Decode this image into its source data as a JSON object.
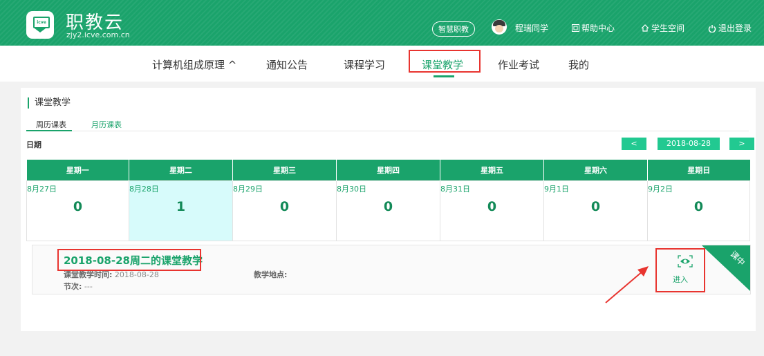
{
  "header": {
    "brand_title": "职教云",
    "brand_subtitle": "zjy2.icve.com.cn",
    "logo_text": "icve",
    "smart_button": "智慧职教",
    "user_name": "程瑞同学",
    "help_center": "帮助中心",
    "student_space": "学生空间",
    "logout": "退出登录"
  },
  "subnav": {
    "course": "计算机组成原理 ^",
    "notice": "通知公告",
    "learning": "课程学习",
    "classroom": "课堂教学",
    "homework": "作业考试",
    "mine": "我的"
  },
  "panel": {
    "title": "课堂教学",
    "tab_week": "周历课表",
    "tab_month": "月历课表",
    "date_label": "日期",
    "prev": "<",
    "next": ">",
    "current_date": "2018-08-28"
  },
  "week": {
    "headers": [
      "星期一",
      "星期二",
      "星期三",
      "星期四",
      "星期五",
      "星期六",
      "星期日"
    ],
    "days": [
      "8月27日",
      "8月28日",
      "8月29日",
      "8月30日",
      "8月31日",
      "9月1日",
      "9月2日"
    ],
    "counts": [
      "0",
      "1",
      "0",
      "0",
      "0",
      "0",
      "0"
    ]
  },
  "card": {
    "title": "2018-08-28周二的课堂教学",
    "time_label": "课堂教学时间:",
    "time_value": "2018-08-28",
    "place_label": "教学地点:",
    "place_value": "",
    "period_label": "节次:",
    "period_value": "---",
    "badge": "课中",
    "enter": "进入"
  },
  "colors": {
    "brand": "#1aa36b",
    "accent": "#22c991",
    "highlight": "#e8342f"
  }
}
